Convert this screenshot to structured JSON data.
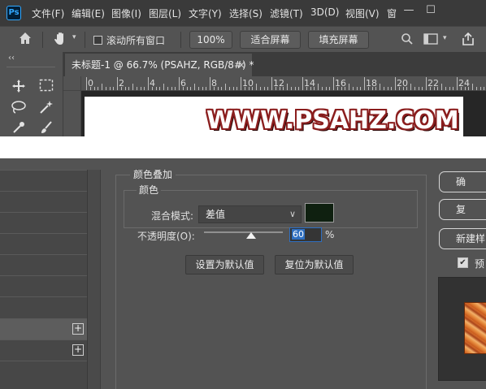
{
  "photoshop": {
    "logo": "Ps",
    "menu": [
      "文件(F)",
      "编辑(E)",
      "图像(I)",
      "图层(L)",
      "文字(Y)",
      "选择(S)",
      "滤镜(T)",
      "3D(D)",
      "视图(V)",
      "窗"
    ],
    "window_controls": {
      "minimize": "—",
      "maximize": "☐"
    },
    "options_bar": {
      "home_icon": "home-icon",
      "hand_icon": "hand-icon",
      "scroll_all_label": "滚动所有窗口",
      "zoom_value": "100%",
      "fit_screen_label": "适合屏幕",
      "fill_screen_label": "填充屏幕"
    },
    "toolbar_collapse": "‹‹",
    "document_tab": {
      "title": "未标题-1 @ 66.7% (PSAHZ, RGB/8#) *",
      "close": "×"
    },
    "ruler_labels": [
      "0",
      "2",
      "4",
      "6",
      "8",
      "10",
      "12",
      "14",
      "16",
      "18",
      "20",
      "22",
      "24"
    ],
    "canvas_text": "WWW.PSAHZ.COM"
  },
  "layer_style": {
    "section_title": "颜色叠加",
    "group_title": "颜色",
    "blend_mode_label": "混合模式:",
    "blend_mode_value": "差值",
    "color_swatch": "#0f2010",
    "opacity_label": "不透明度(O):",
    "opacity_value": "60",
    "opacity_unit": "%",
    "opacity_fraction": 0.6,
    "set_default_label": "设置为默认值",
    "reset_default_label": "复位为默认值",
    "list_plus_buttons": [
      "+",
      "+"
    ],
    "right_buttons": [
      "确",
      "复",
      "新建样"
    ],
    "preview_label": "预",
    "preview_checked": true
  }
}
